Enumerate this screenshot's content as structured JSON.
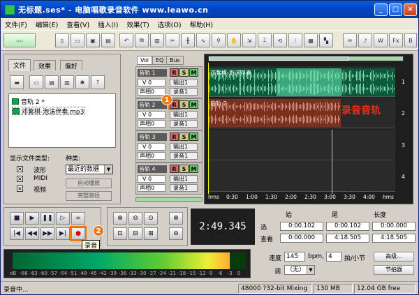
{
  "window": {
    "title": "无标题.ses* - 电脑唱歌录音软件 www.leawo.cn"
  },
  "menu": [
    "文件(F)",
    "编辑(E)",
    "查看(V)",
    "插入(I)",
    "效果(T)",
    "选项(O)",
    "帮助(H)"
  ],
  "left_panel": {
    "tabs": [
      "文件",
      "效果",
      "偏好"
    ],
    "files": [
      "音轨  2 *",
      "邓紫棋-泡沫伴奏.mp3"
    ],
    "show_type_label": "显示文件类型:",
    "types": [
      "波形",
      "MIDI",
      "视频"
    ],
    "sort_label": "种类:",
    "sort_value": "最近的数据",
    "auto_play": "自动播放",
    "full_path": "完整路径"
  },
  "session": {
    "buttons": [
      "Vol",
      "EQ",
      "Bus"
    ],
    "tracks": [
      {
        "name": "音轨 1",
        "vol": "V 0",
        "pan": "声相0",
        "out": "输出1",
        "rec": "录音1"
      },
      {
        "name": "音轨 2",
        "vol": "V 0",
        "pan": "声相0",
        "out": "输出1",
        "rec": "录音1"
      },
      {
        "name": "音轨 3",
        "vol": "V 0",
        "pan": "声相0",
        "out": "输出1",
        "rec": "录音1"
      },
      {
        "name": "音轨 4",
        "vol": "V 0",
        "pan": "声相0",
        "out": "输出1",
        "rec": "录音1"
      }
    ],
    "rsm": [
      "R",
      "S",
      "M"
    ],
    "clip1_label": "邓紫棋-泡沫伴奏",
    "clip2_label": "音轨 2",
    "record_track_label": "录音音轨",
    "lane_numbers": [
      "1",
      "2",
      "3",
      "4"
    ],
    "ruler": [
      "hms",
      "0:30",
      "1:00",
      "1:30",
      "2:00",
      "2:30",
      "3:00",
      "3:30",
      "4:00",
      "hms"
    ]
  },
  "transport": {
    "record_tooltip": "录音"
  },
  "callouts": [
    "1",
    "2"
  ],
  "time_display": "2:49.345",
  "selection": {
    "headers": [
      "始",
      "尾",
      "长度"
    ],
    "rows": [
      {
        "label": "选",
        "start": "0:00.102",
        "end": "0:00.102",
        "length": "0:00.000"
      },
      {
        "label": "查看",
        "start": "0:00.000",
        "end": "4:18.505",
        "length": "4:18.505"
      }
    ]
  },
  "meter": {
    "level": 0.93,
    "ticks": [
      "dB",
      "-66",
      "-63",
      "-60",
      "-57",
      "-54",
      "-51",
      "-48",
      "-45",
      "-42",
      "-39",
      "-36",
      "-33",
      "-30",
      "-27",
      "-24",
      "-21",
      "-18",
      "-15",
      "-12",
      "-9",
      "-6",
      "-3",
      "0"
    ]
  },
  "tempo": {
    "speed_label": "速度",
    "speed_value": "145",
    "bpm_label": "bpm,",
    "beats_value": "4",
    "beats_label": "拍/小节",
    "advanced": "高级...",
    "key_label": "调",
    "key_value": "（无）",
    "metronome": "节拍器"
  },
  "status": {
    "left": "录音中...",
    "format": "48000 ?32-bit Mixing",
    "mem": "130 MB",
    "free": "12.04 GB free"
  },
  "colors": {
    "accent": "#0347c6",
    "clip1": "#0c5a3a",
    "clip2": "#7a3020",
    "callout": "#f07814",
    "red_label": "#e83020"
  }
}
